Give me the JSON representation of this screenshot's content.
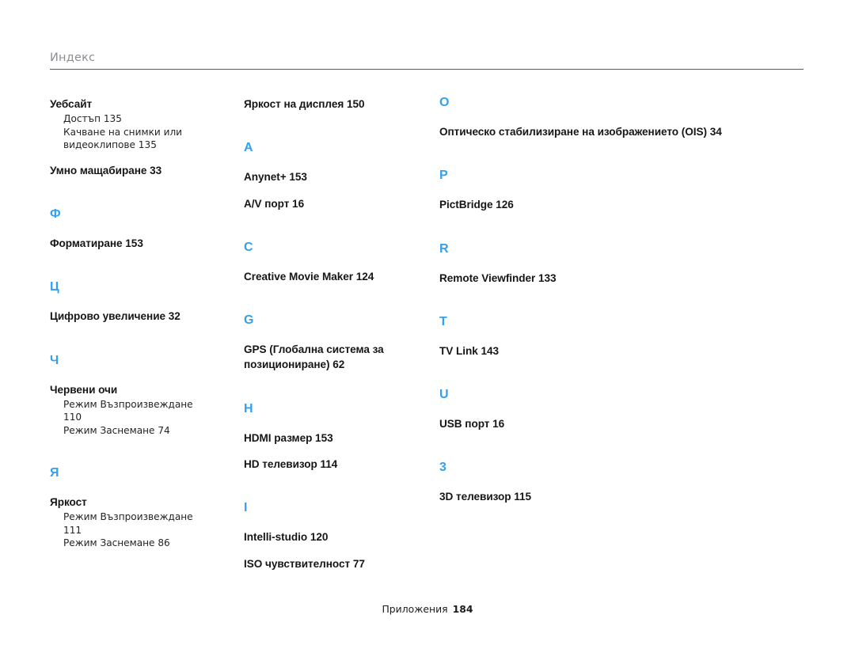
{
  "header": {
    "title": "Индекс"
  },
  "footer": {
    "label": "Приложения",
    "page": "184"
  },
  "colors": {
    "section_letter": "#34A0EE",
    "header_text": "#8d8d92",
    "body_text": "#161616",
    "rule": "#5a5a62"
  },
  "columns": [
    {
      "name": "column-1",
      "blocks": [
        {
          "letter": null,
          "entries": [
            {
              "title": "Уебсайт",
              "subs": [
                "Достъп  135",
                "Качване на снимки или\nвидеоклипове  135"
              ]
            },
            {
              "title": "Умно мащабиране  33",
              "subs": []
            }
          ]
        },
        {
          "letter": "Ф",
          "entries": [
            {
              "title": "Форматиране  153",
              "subs": []
            }
          ]
        },
        {
          "letter": "Ц",
          "entries": [
            {
              "title": "Цифрово увеличение  32",
              "subs": []
            }
          ]
        },
        {
          "letter": "Ч",
          "entries": [
            {
              "title": "Червени очи",
              "subs": [
                "Режим Възпроизвеждане\n110",
                "Режим Заснемане  74"
              ]
            }
          ]
        },
        {
          "letter": "Я",
          "entries": [
            {
              "title": "Яркост",
              "subs": [
                "Режим Възпроизвеждане\n111",
                "Режим Заснемане  86"
              ]
            }
          ]
        }
      ]
    },
    {
      "name": "column-2",
      "blocks": [
        {
          "letter": null,
          "entries": [
            {
              "title": "Яркост на дисплея  150",
              "subs": []
            }
          ]
        },
        {
          "letter": "A",
          "entries": [
            {
              "title": "Anynet+  153",
              "subs": []
            },
            {
              "title": "A/V порт  16",
              "subs": []
            }
          ]
        },
        {
          "letter": "C",
          "entries": [
            {
              "title": "Creative Movie Maker  124",
              "subs": []
            }
          ]
        },
        {
          "letter": "G",
          "entries": [
            {
              "title": "GPS (Глобална система за позициониране)  62",
              "subs": []
            }
          ]
        },
        {
          "letter": "H",
          "entries": [
            {
              "title": "HDMI размер  153",
              "subs": []
            },
            {
              "title": "HD телевизор  114",
              "subs": []
            }
          ]
        },
        {
          "letter": "I",
          "entries": [
            {
              "title": "Intelli-studio  120",
              "subs": []
            },
            {
              "title": "ISO чувствителност  77",
              "subs": []
            }
          ]
        }
      ]
    },
    {
      "name": "column-3",
      "blocks": [
        {
          "letter": "O",
          "entries": [
            {
              "title": "Оптическо стабилизиране на изображението (OIS)  34",
              "subs": []
            }
          ]
        },
        {
          "letter": "P",
          "entries": [
            {
              "title": "PictBridge  126",
              "subs": []
            }
          ]
        },
        {
          "letter": "R",
          "entries": [
            {
              "title": "Remote Viewfinder  133",
              "subs": []
            }
          ]
        },
        {
          "letter": "T",
          "entries": [
            {
              "title": "TV Link  143",
              "subs": []
            }
          ]
        },
        {
          "letter": "U",
          "entries": [
            {
              "title": "USB порт  16",
              "subs": []
            }
          ]
        },
        {
          "letter": "3",
          "entries": [
            {
              "title": "3D телевизор  115",
              "subs": []
            }
          ]
        }
      ]
    }
  ]
}
